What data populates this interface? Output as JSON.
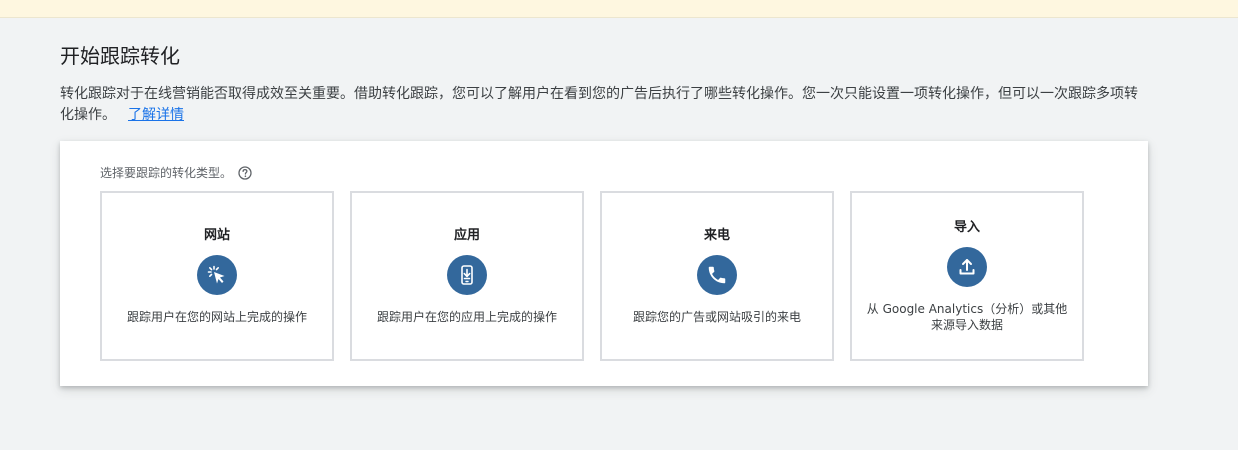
{
  "page": {
    "title": "开始跟踪转化",
    "description": "转化跟踪对于在线营销能否取得成效至关重要。借助转化跟踪，您可以了解用户在看到您的广告后执行了哪些转化操作。您一次只能设置一项转化操作，但可以一次跟踪多项转化操作。",
    "learn_more_label": "了解详情"
  },
  "card": {
    "label": "选择要跟踪的转化类型。",
    "options": [
      {
        "title": "网站",
        "icon": "cursor-click-icon",
        "description": "跟踪用户在您的网站上完成的操作"
      },
      {
        "title": "应用",
        "icon": "mobile-download-icon",
        "description": "跟踪用户在您的应用上完成的操作"
      },
      {
        "title": "来电",
        "icon": "phone-icon",
        "description": "跟踪您的广告或网站吸引的来电"
      },
      {
        "title": "导入",
        "icon": "upload-icon",
        "description": "从 Google Analytics（分析）或其他来源导入数据"
      }
    ]
  },
  "colors": {
    "icon_circle": "#33689c",
    "link": "#1a73e8",
    "banner": "#fef7e0"
  }
}
